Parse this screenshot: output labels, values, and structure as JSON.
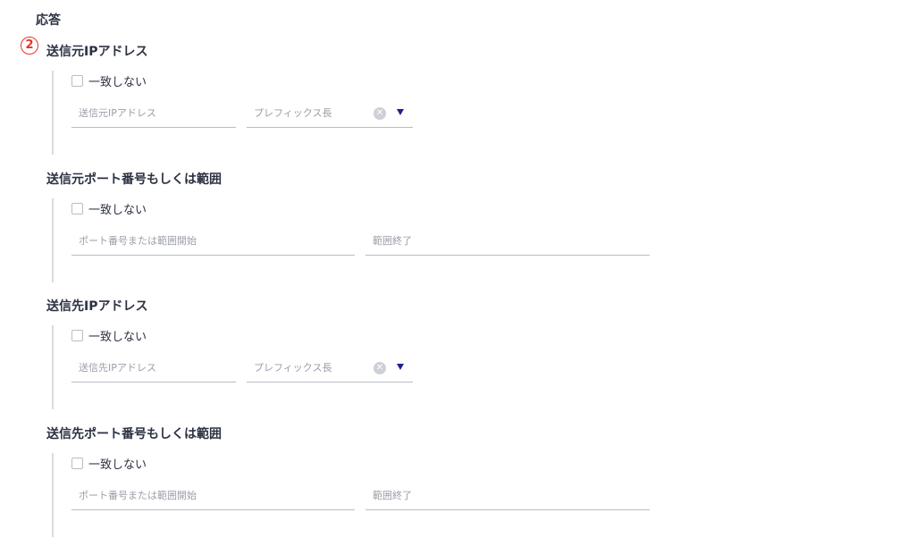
{
  "heading": "応答",
  "marker": "2",
  "sections": [
    {
      "title": "送信元IPアドレス",
      "checkbox_label": "一致しない",
      "field1_placeholder": "送信元IPアドレス",
      "field2_placeholder": "プレフィックス長"
    },
    {
      "title": "送信元ポート番号もしくは範囲",
      "checkbox_label": "一致しない",
      "field1_placeholder": "ポート番号または範囲開始",
      "field2_placeholder": "範囲終了"
    },
    {
      "title": "送信先IPアドレス",
      "checkbox_label": "一致しない",
      "field1_placeholder": "送信先IPアドレス",
      "field2_placeholder": "プレフィックス長"
    },
    {
      "title": "送信先ポート番号もしくは範囲",
      "checkbox_label": "一致しない",
      "field1_placeholder": "ポート番号または範囲開始",
      "field2_placeholder": "範囲終了"
    }
  ],
  "icons": {
    "clear": "clear-icon",
    "dropdown": "dropdown-arrow-icon",
    "marker": "numbered-circle-icon"
  },
  "colors": {
    "marker": "#e8322a",
    "dropdown_arrow": "#1f1f8f"
  }
}
